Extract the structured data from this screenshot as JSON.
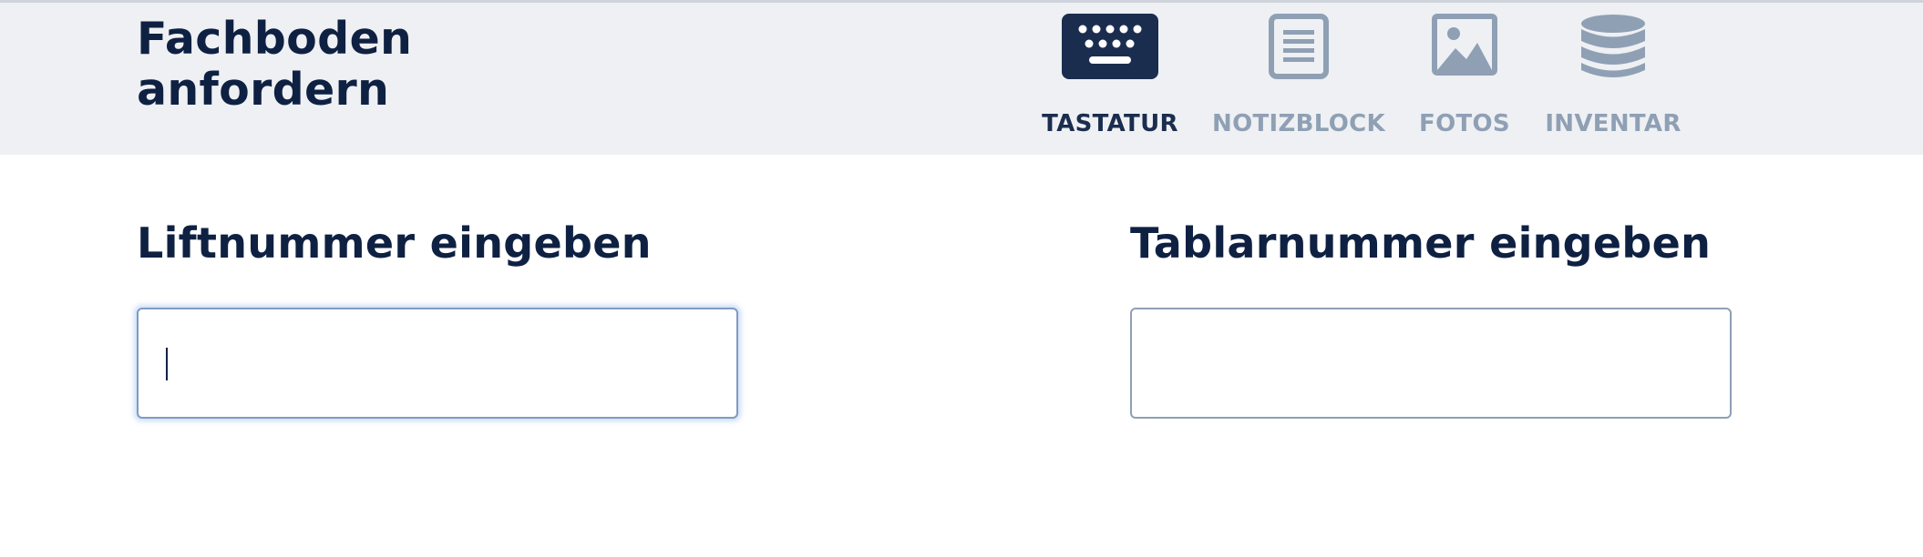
{
  "header": {
    "title": "Fachboden anfordern",
    "nav": [
      {
        "id": "tastatur",
        "label": "TASTATUR",
        "icon": "keyboard-icon",
        "active": true
      },
      {
        "id": "notizblock",
        "label": "NOTIZBLOCK",
        "icon": "notepad-icon",
        "active": false
      },
      {
        "id": "fotos",
        "label": "FOTOS",
        "icon": "image-icon",
        "active": false
      },
      {
        "id": "inventar",
        "label": "INVENTAR",
        "icon": "database-icon",
        "active": false
      }
    ]
  },
  "form": {
    "lift": {
      "label": "Liftnummer eingeben",
      "value": "",
      "placeholder": ""
    },
    "tablar": {
      "label": "Tablarnummer eingeben",
      "value": "",
      "placeholder": ""
    }
  },
  "colors": {
    "primary": "#1b2d4f",
    "inactive": "#8fa0b5",
    "header_bg": "#eef0f3",
    "focus_glow": "#6ea0e6"
  }
}
